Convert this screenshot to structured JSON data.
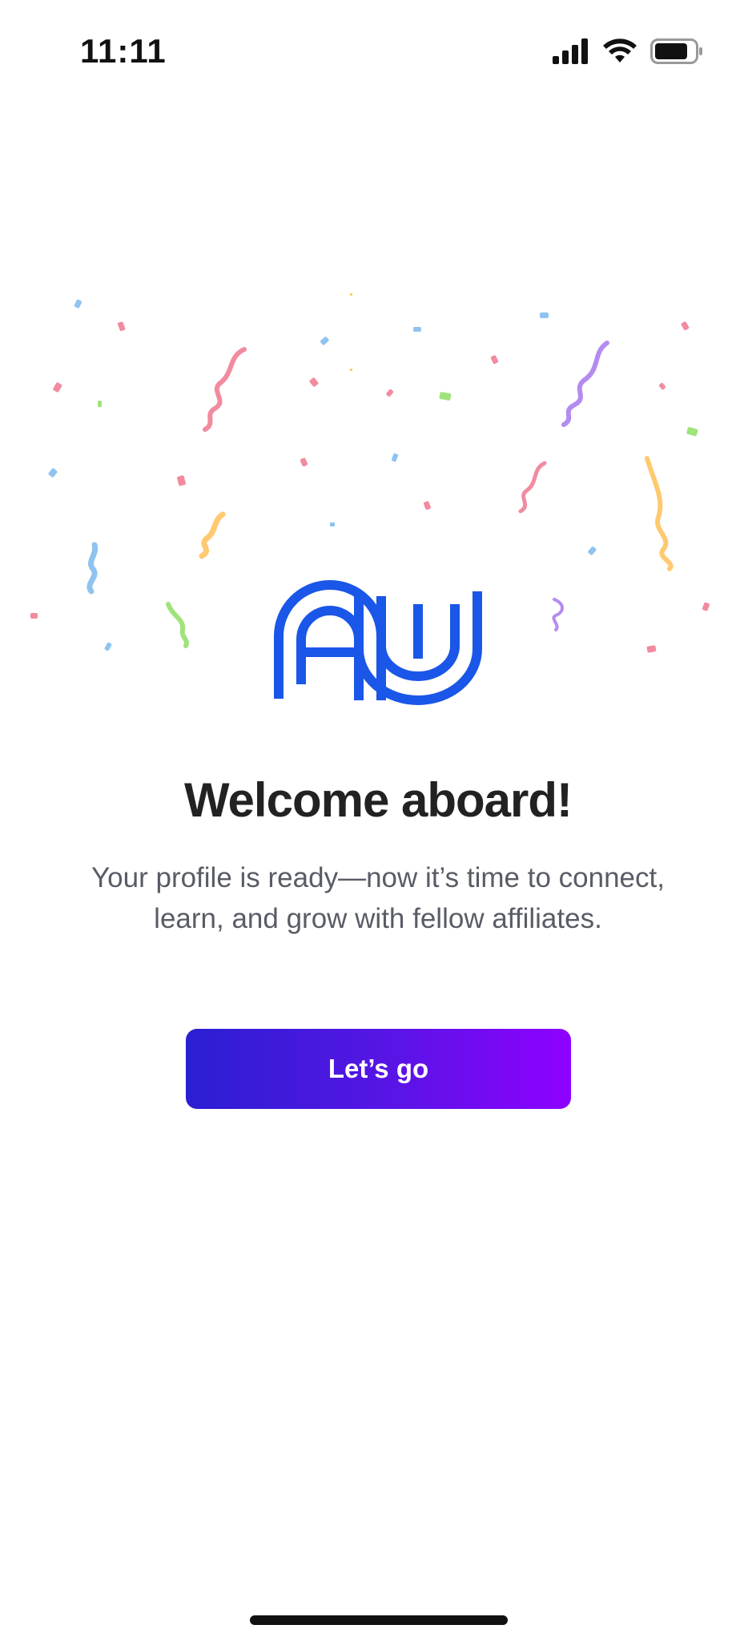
{
  "status_bar": {
    "time": "11:11",
    "icons": [
      "cellular-signal-icon",
      "wifi-icon",
      "battery-icon"
    ]
  },
  "logo": {
    "icon": "aw-logo-icon",
    "color": "#1a56e8"
  },
  "welcome": {
    "title": "Welcome aboard!",
    "subtitle": "Your profile is ready—now it’s time to connect, learn, and grow with fellow affiliates."
  },
  "cta": {
    "label": "Let’s go"
  },
  "colors": {
    "title": "#222222",
    "subtitle": "#595c66",
    "button_gradient_start": "#2a1fd2",
    "button_gradient_end": "#8f00ff",
    "confetti": [
      "#f28b9f",
      "#8fc3f0",
      "#b48cf0",
      "#ffc970",
      "#9fe37a"
    ]
  }
}
